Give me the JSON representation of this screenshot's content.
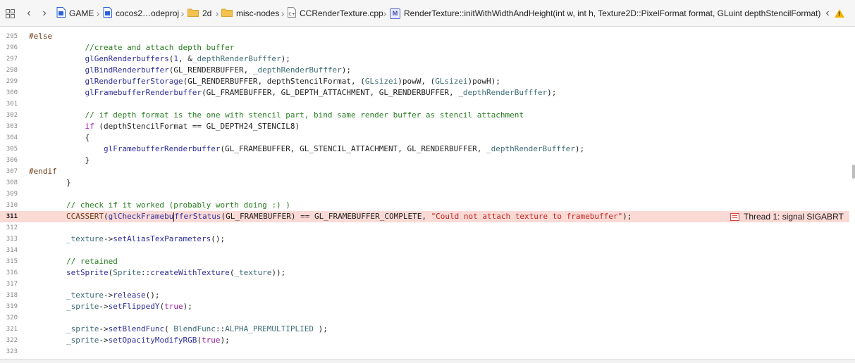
{
  "jumpbar": {
    "crumbs": [
      {
        "label": "GAME",
        "icon": "xcode-project-icon"
      },
      {
        "label": "cocos2…odeproj",
        "icon": "xcode-project-icon"
      },
      {
        "label": "2d",
        "icon": "folder-icon"
      },
      {
        "label": "misc-nodes",
        "icon": "folder-icon"
      },
      {
        "label": "CCRenderTexture.cpp",
        "icon": "cpp-file-icon"
      },
      {
        "label": "RenderTexture::initWithWidthAndHeight(int w, int h, Texture2D::PixelFormat format, GLuint depthStencilFormat)",
        "icon": "method-icon",
        "badge": "M"
      }
    ],
    "issue_badge": "!"
  },
  "editor": {
    "lines": [
      {
        "num": "295",
        "tokens": [
          [
            "pp",
            "#else"
          ]
        ]
      },
      {
        "num": "296",
        "tokens": [
          [
            "pl",
            "            "
          ],
          [
            "cm",
            "//create and attach depth buffer"
          ]
        ]
      },
      {
        "num": "297",
        "tokens": [
          [
            "pl",
            "            "
          ],
          [
            "fn",
            "glGenRenderbuffers"
          ],
          [
            "pl",
            "("
          ],
          [
            "nm",
            "1"
          ],
          [
            "pl",
            ", &"
          ],
          [
            "mb",
            "_depthRenderBufffer"
          ],
          [
            "pl",
            ");"
          ]
        ]
      },
      {
        "num": "298",
        "tokens": [
          [
            "pl",
            "            "
          ],
          [
            "fn",
            "glBindRenderbuffer"
          ],
          [
            "pl",
            "(GL_RENDERBUFFER, "
          ],
          [
            "mb",
            "_depthRenderBufffer"
          ],
          [
            "pl",
            ");"
          ]
        ]
      },
      {
        "num": "299",
        "tokens": [
          [
            "pl",
            "            "
          ],
          [
            "fn",
            "glRenderbufferStorage"
          ],
          [
            "pl",
            "(GL_RENDERBUFFER, depthStencilFormat, ("
          ],
          [
            "ty",
            "GLsizei"
          ],
          [
            "pl",
            ")powW, ("
          ],
          [
            "ty",
            "GLsizei"
          ],
          [
            "pl",
            ")powH);"
          ]
        ]
      },
      {
        "num": "300",
        "tokens": [
          [
            "pl",
            "            "
          ],
          [
            "fn",
            "glFramebufferRenderbuffer"
          ],
          [
            "pl",
            "(GL_FRAMEBUFFER, GL_DEPTH_ATTACHMENT, GL_RENDERBUFFER, "
          ],
          [
            "mb",
            "_depthRenderBufffer"
          ],
          [
            "pl",
            ");"
          ]
        ]
      },
      {
        "num": "301",
        "tokens": []
      },
      {
        "num": "302",
        "tokens": [
          [
            "pl",
            "            "
          ],
          [
            "cm",
            "// if depth format is the one with stencil part, bind same render buffer as stencil attachment"
          ]
        ]
      },
      {
        "num": "303",
        "tokens": [
          [
            "pl",
            "            "
          ],
          [
            "kw",
            "if"
          ],
          [
            "pl",
            " (depthStencilFormat == GL_DEPTH24_STENCIL8)"
          ]
        ]
      },
      {
        "num": "304",
        "tokens": [
          [
            "pl",
            "            {"
          ]
        ]
      },
      {
        "num": "305",
        "tokens": [
          [
            "pl",
            "                "
          ],
          [
            "fn",
            "glFramebufferRenderbuffer"
          ],
          [
            "pl",
            "(GL_FRAMEBUFFER, GL_STENCIL_ATTACHMENT, GL_RENDERBUFFER, "
          ],
          [
            "mb",
            "_depthRenderBufffer"
          ],
          [
            "pl",
            ");"
          ]
        ]
      },
      {
        "num": "306",
        "tokens": [
          [
            "pl",
            "            }"
          ]
        ]
      },
      {
        "num": "307",
        "tokens": [
          [
            "pp",
            "#endif"
          ]
        ]
      },
      {
        "num": "308",
        "tokens": [
          [
            "pl",
            "        }"
          ]
        ]
      },
      {
        "num": "309",
        "tokens": []
      },
      {
        "num": "310",
        "tokens": [
          [
            "pl",
            "        "
          ],
          [
            "cm",
            "// check if it worked (probably worth doing :) )"
          ]
        ]
      },
      {
        "num": "311",
        "error": true,
        "tokens": [
          [
            "pp",
            "        CCASSERT"
          ],
          [
            "pl",
            "("
          ],
          [
            "fn",
            "glCheckFramebu"
          ],
          [
            "cursor",
            ""
          ],
          [
            "fn",
            "fferStatus"
          ],
          [
            "pl",
            "(GL_FRAMEBUFFER) == GL_FRAMEBUFFER_COMPLETE, "
          ],
          [
            "st",
            "\"Could not attach texture to framebuffer\""
          ],
          [
            "pl",
            ");"
          ]
        ]
      },
      {
        "num": "312",
        "tokens": []
      },
      {
        "num": "313",
        "tokens": [
          [
            "pl",
            "        "
          ],
          [
            "mb",
            "_texture"
          ],
          [
            "pl",
            "->"
          ],
          [
            "fn",
            "setAliasTexParameters"
          ],
          [
            "pl",
            "();"
          ]
        ]
      },
      {
        "num": "314",
        "tokens": []
      },
      {
        "num": "315",
        "tokens": [
          [
            "pl",
            "        "
          ],
          [
            "cm",
            "// retained"
          ]
        ]
      },
      {
        "num": "316",
        "tokens": [
          [
            "pl",
            "        "
          ],
          [
            "fn",
            "setSprite"
          ],
          [
            "pl",
            "("
          ],
          [
            "ty",
            "Sprite"
          ],
          [
            "pl",
            "::"
          ],
          [
            "fn",
            "createWithTexture"
          ],
          [
            "pl",
            "("
          ],
          [
            "mb",
            "_texture"
          ],
          [
            "pl",
            "));"
          ]
        ]
      },
      {
        "num": "317",
        "tokens": []
      },
      {
        "num": "318",
        "tokens": [
          [
            "pl",
            "        "
          ],
          [
            "mb",
            "_texture"
          ],
          [
            "pl",
            "->"
          ],
          [
            "fn",
            "release"
          ],
          [
            "pl",
            "();"
          ]
        ]
      },
      {
        "num": "319",
        "tokens": [
          [
            "pl",
            "        "
          ],
          [
            "mb",
            "_sprite"
          ],
          [
            "pl",
            "->"
          ],
          [
            "fn",
            "setFlippedY"
          ],
          [
            "pl",
            "("
          ],
          [
            "kw",
            "true"
          ],
          [
            "pl",
            ");"
          ]
        ]
      },
      {
        "num": "320",
        "tokens": []
      },
      {
        "num": "321",
        "tokens": [
          [
            "pl",
            "        "
          ],
          [
            "mb",
            "_sprite"
          ],
          [
            "pl",
            "->"
          ],
          [
            "fn",
            "setBlendFunc"
          ],
          [
            "pl",
            "( "
          ],
          [
            "ty",
            "BlendFunc"
          ],
          [
            "pl",
            "::"
          ],
          [
            "ty",
            "ALPHA_PREMULTIPLIED"
          ],
          [
            "pl",
            " );"
          ]
        ]
      },
      {
        "num": "322",
        "tokens": [
          [
            "pl",
            "        "
          ],
          [
            "mb",
            "_sprite"
          ],
          [
            "pl",
            "->"
          ],
          [
            "fn",
            "setOpacityModifyRGB"
          ],
          [
            "pl",
            "("
          ],
          [
            "kw",
            "true"
          ],
          [
            "pl",
            ");"
          ]
        ]
      },
      {
        "num": "323",
        "tokens": []
      }
    ],
    "error_annotation": {
      "line": "311",
      "text": "Thread 1: signal SIGABRT"
    }
  }
}
